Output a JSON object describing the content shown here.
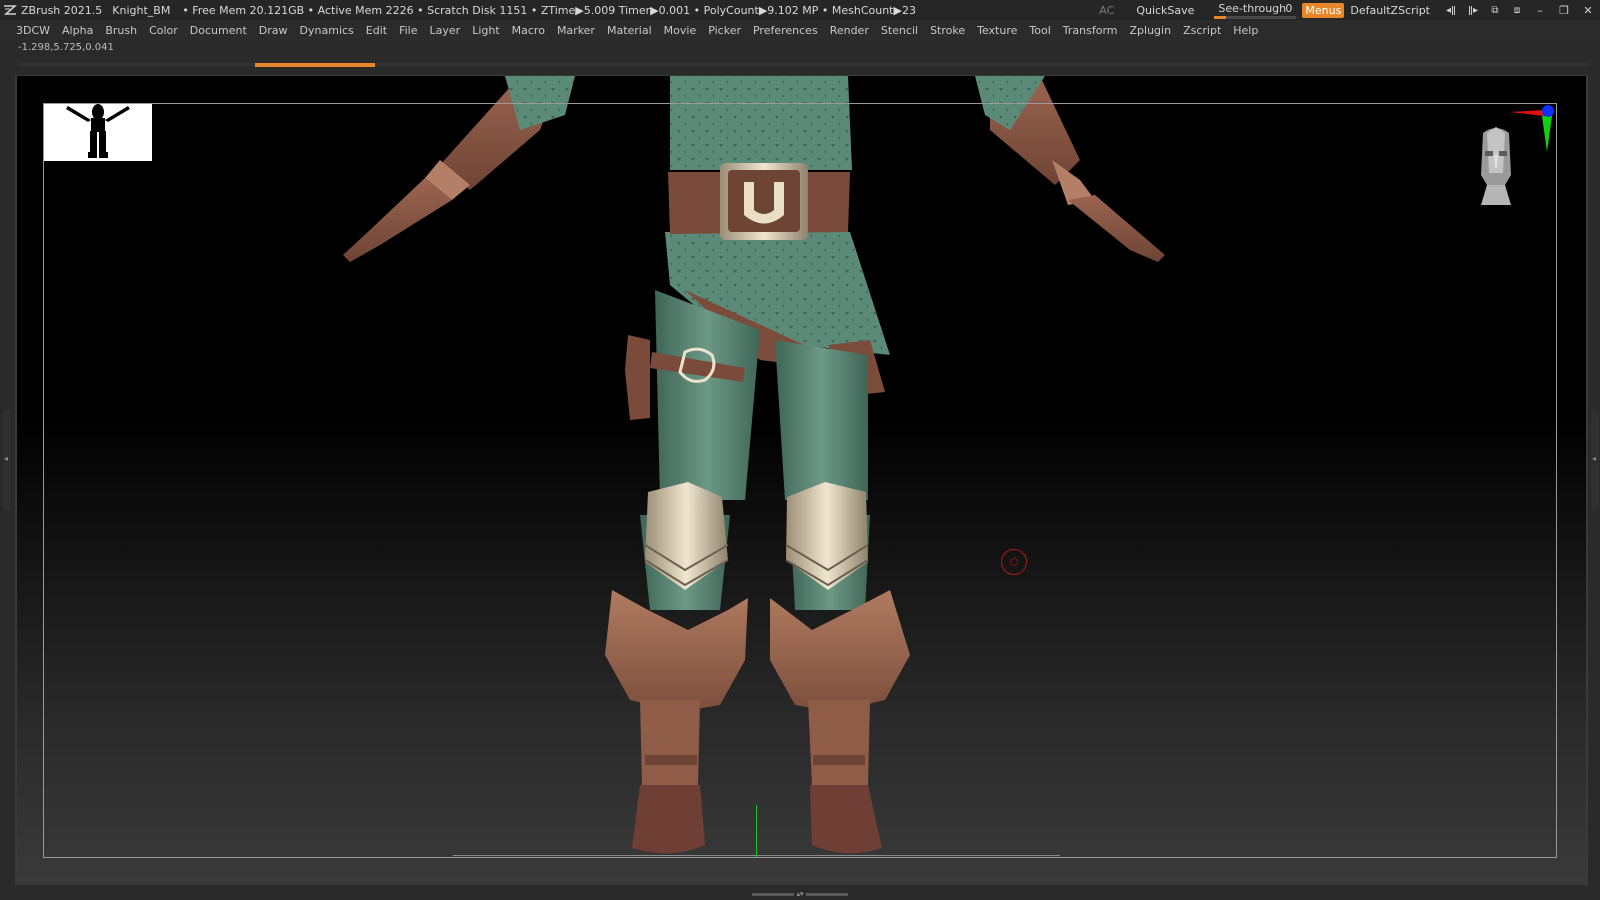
{
  "titlebar": {
    "app_version": "ZBrush 2021.5",
    "document_name": "Knight_BM",
    "stats": "• Free Mem 20.121GB • Active Mem 2226 • Scratch Disk 1151 • ZTime▶5.009 Timer▶0.001 • PolyCount▶9.102 MP • MeshCount▶23",
    "ac_label": "AC",
    "quicksave_label": "QuickSave",
    "seethrough_label": "See-through",
    "seethrough_value": "0",
    "menus_label": "Menus",
    "default_zscript_label": "DefaultZScript"
  },
  "menubar": {
    "items": [
      "3DCW",
      "Alpha",
      "Brush",
      "Color",
      "Document",
      "Draw",
      "Dynamics",
      "Edit",
      "File",
      "Layer",
      "Light",
      "Macro",
      "Marker",
      "Material",
      "Movie",
      "Picker",
      "Preferences",
      "Render",
      "Stencil",
      "Stroke",
      "Texture",
      "Tool",
      "Transform",
      "Zplugin",
      "Zscript",
      "Help"
    ]
  },
  "status": {
    "coordinates": "-1.298,5.725,0.041"
  },
  "colors": {
    "accent": "#e8872a",
    "cloth_green": "#5c8a78",
    "leather_brown": "#8a5a45",
    "metal_gold": "#d8c7a4"
  },
  "icons": {
    "logo": "zbrush-logo-icon",
    "gizmo": "axis-gizmo-icon",
    "headcube": "navigation-head-icon"
  }
}
